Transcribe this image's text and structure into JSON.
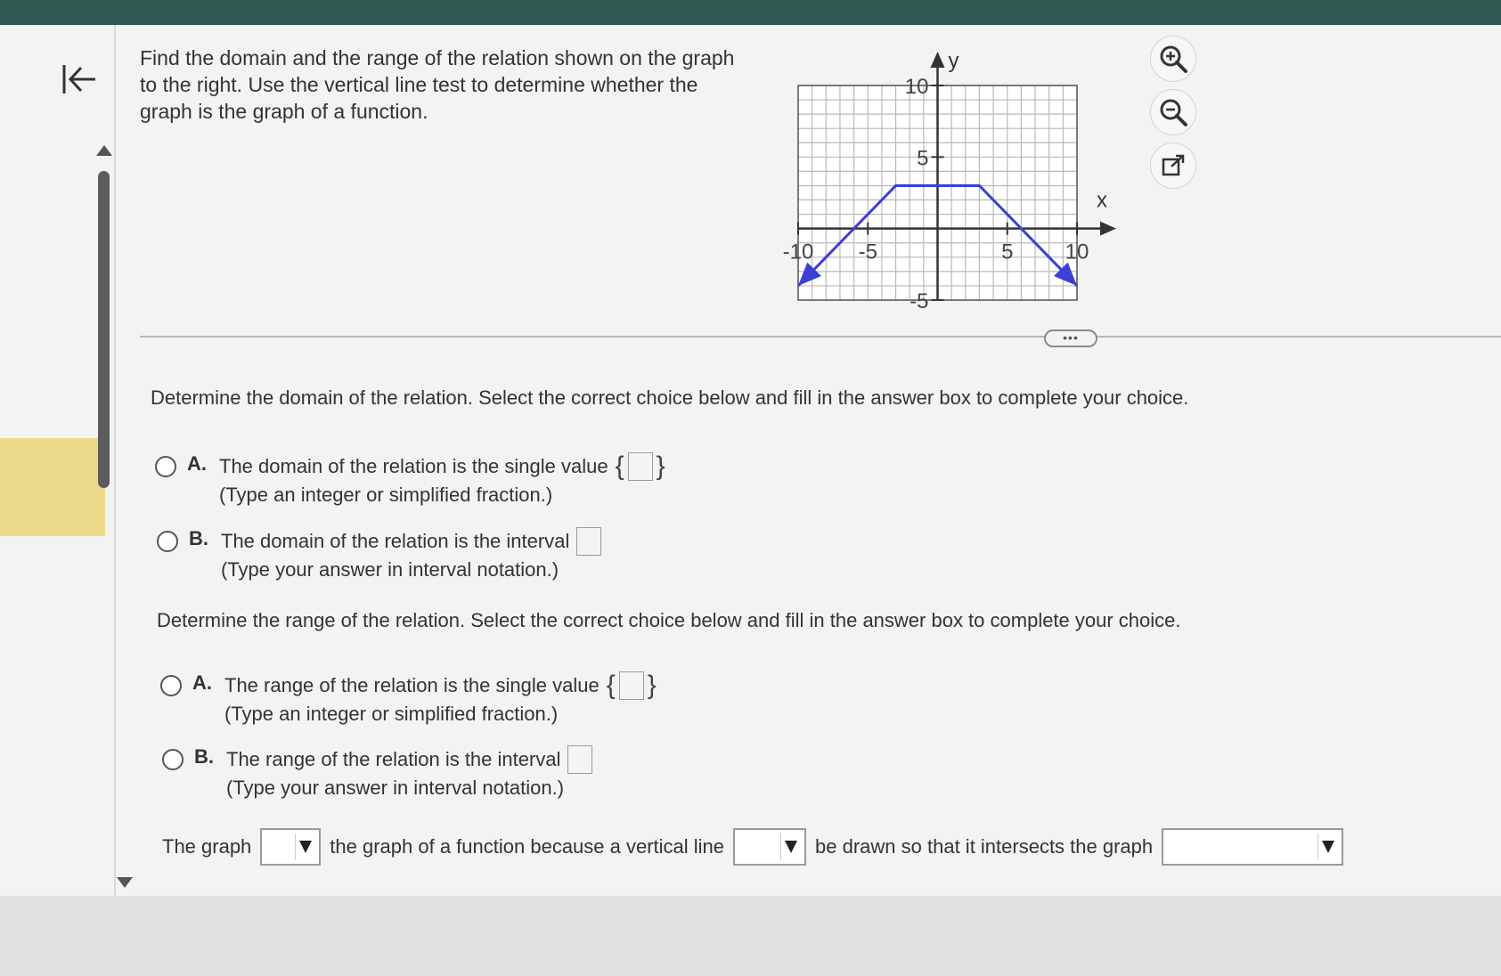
{
  "question": {
    "text": "Find the domain and the range of the relation shown on the graph to the right. Use the vertical line test to determine whether the graph is the graph of a function."
  },
  "graph": {
    "x_axis_label": "x",
    "y_axis_label": "y",
    "x_tick_labels": [
      "-10",
      "-5",
      "5",
      "10"
    ],
    "y_tick_labels": [
      "10",
      "5",
      "-5"
    ],
    "x_range": [
      -10,
      10
    ],
    "y_range": [
      -5,
      10
    ],
    "grid_step": 1,
    "line_color": "#3b3fd8",
    "vertices": [
      [
        -10,
        -4
      ],
      [
        -3,
        3
      ],
      [
        3,
        3
      ],
      [
        10,
        -4
      ]
    ],
    "arrow_at_both_ends": true
  },
  "tools": {
    "zoom_in_icon": "zoom-in-icon",
    "zoom_out_icon": "zoom-out-icon",
    "popout_icon": "external-link-icon"
  },
  "expand_label": "•••",
  "domain_section": {
    "prompt": "Determine the domain of the relation. Select the correct choice below and fill in the answer box to complete your choice.",
    "choice_a": {
      "letter": "A.",
      "text": "The domain of the relation is the single value",
      "hint": "(Type an integer or simplified fraction.)"
    },
    "choice_b": {
      "letter": "B.",
      "text": "The domain of the relation is the interval",
      "hint": "(Type your answer in interval notation.)"
    }
  },
  "range_section": {
    "prompt": "Determine the range of the relation. Select the correct choice below and fill in the answer box to complete your choice.",
    "choice_a": {
      "letter": "A.",
      "text": "The range of the relation is the single value",
      "hint": "(Type an integer or simplified fraction.)"
    },
    "choice_b": {
      "letter": "B.",
      "text": "The range of the relation is the interval",
      "hint": "(Type your answer in interval notation.)"
    }
  },
  "function_sentence": {
    "part1": "The graph",
    "part2": "the graph of a function because a vertical line",
    "part3": "be drawn so that it intersects the graph"
  },
  "colors": {
    "topbar": "#2e5a52",
    "highlight": "#ecd98a",
    "graph_line": "#3b3fd8"
  }
}
